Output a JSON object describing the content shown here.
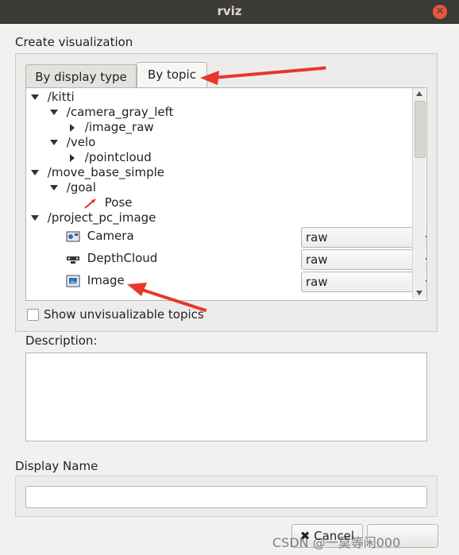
{
  "window": {
    "title": "rviz"
  },
  "dialog": {
    "heading": "Create visualization",
    "tabs": [
      {
        "label": "By display type",
        "active": false
      },
      {
        "label": "By topic",
        "active": true
      }
    ],
    "tree": [
      {
        "label": "/kitti",
        "level": 0,
        "state": "expanded"
      },
      {
        "label": "/camera_gray_left",
        "level": 1,
        "state": "expanded"
      },
      {
        "label": "/image_raw",
        "level": 2,
        "state": "collapsed"
      },
      {
        "label": "/velo",
        "level": 1,
        "state": "expanded"
      },
      {
        "label": "/pointcloud",
        "level": 2,
        "state": "collapsed"
      },
      {
        "label": "/move_base_simple",
        "level": 0,
        "state": "expanded"
      },
      {
        "label": "/goal",
        "level": 1,
        "state": "expanded"
      },
      {
        "label": "Pose",
        "level": 2,
        "state": "display",
        "icon": "pose-arrow-icon"
      },
      {
        "label": "/project_pc_image",
        "level": 0,
        "state": "expanded"
      },
      {
        "label": "Camera",
        "level": 1,
        "state": "display",
        "icon": "camera-icon",
        "combo": "raw"
      },
      {
        "label": "DepthCloud",
        "level": 1,
        "state": "display",
        "icon": "depthcloud-icon",
        "combo": "raw"
      },
      {
        "label": "Image",
        "level": 1,
        "state": "display",
        "icon": "image-icon",
        "combo": "raw"
      }
    ],
    "show_unvisualizable": {
      "label": "Show unvisualizable topics",
      "checked": false
    },
    "description": {
      "label": "Description:",
      "value": ""
    },
    "display_name": {
      "label": "Display Name",
      "value": ""
    },
    "buttons": {
      "cancel": "Cancel"
    },
    "watermark": "CSDN @一莫等闲000"
  },
  "colors": {
    "annotation_arrow": "#e8372c",
    "titlebar": "#3c3b37",
    "close": "#e9573f"
  }
}
